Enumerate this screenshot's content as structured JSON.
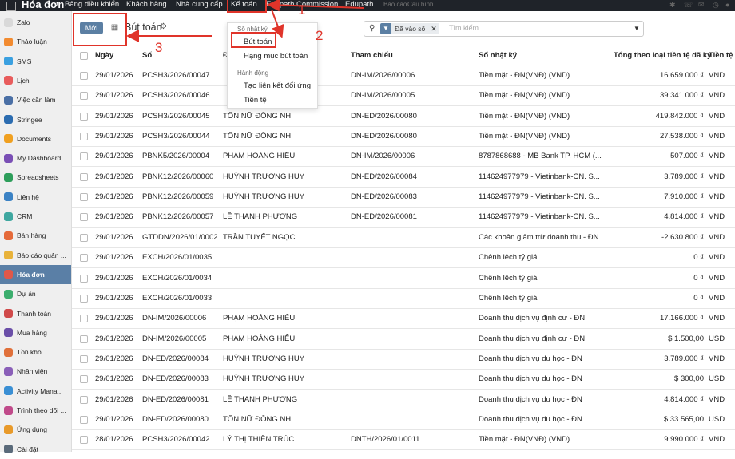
{
  "topbar": {
    "app_title": "Hóa đơn",
    "menu": [
      "Bảng điều khiển",
      "Khách hàng",
      "Nhà cung cấp",
      "Kế toán",
      "Edupath Commission",
      "Edupath"
    ],
    "faded_menu": [
      "Báo cáo",
      "Cấu hình"
    ]
  },
  "sidebar": {
    "items": [
      {
        "label": "Zalo",
        "color": "#d9d9d9"
      },
      {
        "label": "Thảo luận",
        "color": "#f28b30"
      },
      {
        "label": "SMS",
        "color": "#3aa0e0"
      },
      {
        "label": "Lịch",
        "color": "#e85c5c"
      },
      {
        "label": "Việc cần làm",
        "color": "#4a6fa5"
      },
      {
        "label": "Stringee",
        "color": "#2b6cb0"
      },
      {
        "label": "Documents",
        "color": "#f0a020"
      },
      {
        "label": "My Dashboard",
        "color": "#7a4fb5"
      },
      {
        "label": "Spreadsheets",
        "color": "#2e9e5b"
      },
      {
        "label": "Liên hệ",
        "color": "#3b82c4"
      },
      {
        "label": "CRM",
        "color": "#3fa7a0"
      },
      {
        "label": "Bán hàng",
        "color": "#e56a3a"
      },
      {
        "label": "Báo cáo quản ...",
        "color": "#e8b23a"
      },
      {
        "label": "Hóa đơn",
        "color": "#e0584a",
        "active": true
      },
      {
        "label": "Dự án",
        "color": "#3cae6e"
      },
      {
        "label": "Thanh toán",
        "color": "#d04a4a"
      },
      {
        "label": "Mua hàng",
        "color": "#6b4fa8"
      },
      {
        "label": "Tồn kho",
        "color": "#e0703a"
      },
      {
        "label": "Nhân viên",
        "color": "#8a5fb8"
      },
      {
        "label": "Activity Mana...",
        "color": "#3a8fd4"
      },
      {
        "label": "Trình theo dõi ...",
        "color": "#c04a8a"
      },
      {
        "label": "Ứng dụng",
        "color": "#e89a2a"
      },
      {
        "label": "Cài đặt",
        "color": "#5a6a7a"
      }
    ]
  },
  "control": {
    "new_label": "Mới",
    "breadcrumb": "Bút toán",
    "filter_label": "Đã vào sổ",
    "search_placeholder": "Tìm kiếm..."
  },
  "table": {
    "headers": {
      "date": "Ngày",
      "number": "Số",
      "partner": "Đ",
      "reference": "Tham chiếu",
      "journal": "Sổ nhật ký",
      "amount": "Tổng theo loại tiền tệ đã ký",
      "currency": "Tiền tệ"
    },
    "rows": [
      {
        "date": "29/01/2026",
        "number": "PCSH3/2026/00047",
        "partner": "",
        "ref": "DN-IM/2026/00006",
        "journal": "Tiền mặt - ĐN(VNĐ) (VND)",
        "amount": "16.659.000 ₫",
        "cur": "VND"
      },
      {
        "date": "29/01/2026",
        "number": "PCSH3/2026/00046",
        "partner": "",
        "ref": "DN-IM/2026/00005",
        "journal": "Tiền mặt - ĐN(VNĐ) (VND)",
        "amount": "39.341.000 ₫",
        "cur": "VND"
      },
      {
        "date": "29/01/2026",
        "number": "PCSH3/2026/00045",
        "partner": "TÔN NỮ ĐÔNG NHI",
        "ref": "DN-ED/2026/00080",
        "journal": "Tiền mặt - ĐN(VNĐ) (VND)",
        "amount": "419.842.000 ₫",
        "cur": "VND"
      },
      {
        "date": "29/01/2026",
        "number": "PCSH3/2026/00044",
        "partner": "TÔN NỮ ĐÔNG NHI",
        "ref": "DN-ED/2026/00080",
        "journal": "Tiền mặt - ĐN(VNĐ) (VND)",
        "amount": "27.538.000 ₫",
        "cur": "VND"
      },
      {
        "date": "29/01/2026",
        "number": "PBNK5/2026/00004",
        "partner": "PHẠM HOÀNG HIẾU",
        "ref": "DN-IM/2026/00006",
        "journal": "8787868688 - MB Bank TP. HCM (...",
        "amount": "507.000 ₫",
        "cur": "VND"
      },
      {
        "date": "29/01/2026",
        "number": "PBNK12/2026/00060",
        "partner": "HUỲNH TRƯƠNG HUY",
        "ref": "DN-ED/2026/00084",
        "journal": "114624977979 - Vietinbank-CN. S...",
        "amount": "3.789.000 ₫",
        "cur": "VND"
      },
      {
        "date": "29/01/2026",
        "number": "PBNK12/2026/00059",
        "partner": "HUỲNH TRƯƠNG HUY",
        "ref": "DN-ED/2026/00083",
        "journal": "114624977979 - Vietinbank-CN. S...",
        "amount": "7.910.000 ₫",
        "cur": "VND"
      },
      {
        "date": "29/01/2026",
        "number": "PBNK12/2026/00057",
        "partner": "LÊ THANH PHƯƠNG",
        "ref": "DN-ED/2026/00081",
        "journal": "114624977979 - Vietinbank-CN. S...",
        "amount": "4.814.000 ₫",
        "cur": "VND"
      },
      {
        "date": "29/01/2026",
        "number": "GTDDN/2026/01/0002",
        "partner": "TRẦN TUYẾT NGỌC",
        "ref": "",
        "journal": "Các khoản giảm trừ doanh thu - ĐN",
        "amount": "-2.630.800 ₫",
        "cur": "VND"
      },
      {
        "date": "29/01/2026",
        "number": "EXCH/2026/01/0035",
        "partner": "",
        "ref": "",
        "journal": "Chênh lệch tỷ giá",
        "amount": "0 ₫",
        "cur": "VND"
      },
      {
        "date": "29/01/2026",
        "number": "EXCH/2026/01/0034",
        "partner": "",
        "ref": "",
        "journal": "Chênh lệch tỷ giá",
        "amount": "0 ₫",
        "cur": "VND"
      },
      {
        "date": "29/01/2026",
        "number": "EXCH/2026/01/0033",
        "partner": "",
        "ref": "",
        "journal": "Chênh lệch tỷ giá",
        "amount": "0 ₫",
        "cur": "VND"
      },
      {
        "date": "29/01/2026",
        "number": "DN-IM/2026/00006",
        "partner": "PHẠM HOÀNG HIẾU",
        "ref": "",
        "journal": "Doanh thu dịch vụ định cư - ĐN",
        "amount": "17.166.000 ₫",
        "cur": "VND"
      },
      {
        "date": "29/01/2026",
        "number": "DN-IM/2026/00005",
        "partner": "PHẠM HOÀNG HIẾU",
        "ref": "",
        "journal": "Doanh thu dịch vụ định cư - ĐN",
        "amount": "$ 1.500,00",
        "cur": "USD"
      },
      {
        "date": "29/01/2026",
        "number": "DN-ED/2026/00084",
        "partner": "HUỲNH TRƯƠNG HUY",
        "ref": "",
        "journal": "Doanh thu dịch vụ du học - ĐN",
        "amount": "3.789.000 ₫",
        "cur": "VND"
      },
      {
        "date": "29/01/2026",
        "number": "DN-ED/2026/00083",
        "partner": "HUỲNH TRƯƠNG HUY",
        "ref": "",
        "journal": "Doanh thu dịch vụ du học - ĐN",
        "amount": "$ 300,00",
        "cur": "USD"
      },
      {
        "date": "29/01/2026",
        "number": "DN-ED/2026/00081",
        "partner": "LÊ THANH PHƯƠNG",
        "ref": "",
        "journal": "Doanh thu dịch vụ du học - ĐN",
        "amount": "4.814.000 ₫",
        "cur": "VND"
      },
      {
        "date": "29/01/2026",
        "number": "DN-ED/2026/00080",
        "partner": "TÔN NỮ ĐÔNG NHI",
        "ref": "",
        "journal": "Doanh thu dịch vụ du học - ĐN",
        "amount": "$ 33.565,00",
        "cur": "USD"
      },
      {
        "date": "28/01/2026",
        "number": "PCSH3/2026/00042",
        "partner": "LÝ THỊ THIÊN TRÚC",
        "ref": "DNTH/2026/01/0011",
        "journal": "Tiền mặt - ĐN(VNĐ) (VND)",
        "amount": "9.990.000 ₫",
        "cur": "VND"
      }
    ]
  },
  "dropdown": {
    "section_journals": "Sổ nhật ký",
    "item_entries": "Bút toán",
    "item_lines": "Hạng mục bút toán",
    "section_actions": "Hành động",
    "item_reconcile": "Tạo liên kết đối ứng",
    "item_currency": "Tiền tệ"
  },
  "annotations": {
    "step1": "1",
    "step2": "2",
    "step3": "3",
    "color": "#e0342a"
  }
}
